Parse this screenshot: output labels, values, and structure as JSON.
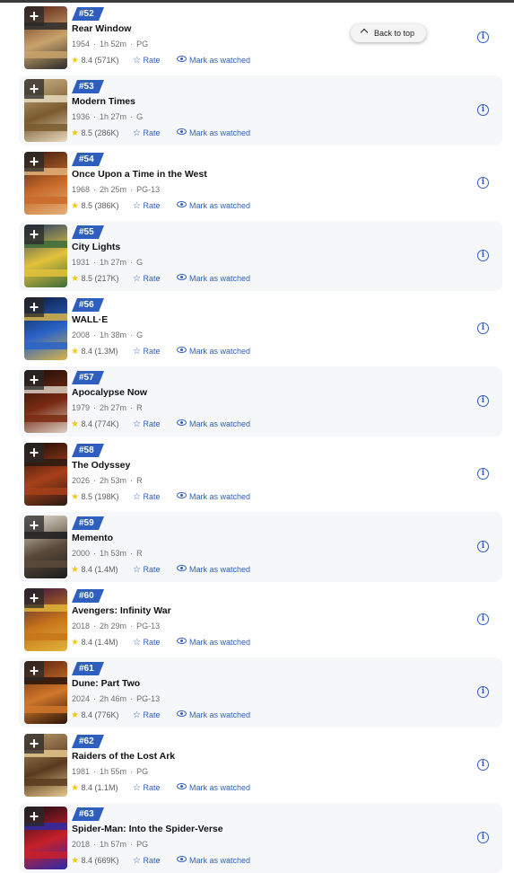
{
  "back_to_top": "Back to top",
  "labels": {
    "rate": "Rate",
    "mark_watched": "Mark as watched",
    "plus": "+",
    "info": "i",
    "star": "★"
  },
  "colors": {
    "accent": "#2f5fbe",
    "star": "#f5c518"
  },
  "movies": [
    {
      "rank": "#52",
      "title": "Rear Window",
      "year": "1954",
      "runtime": "1h 52m",
      "cert": "PG",
      "rating": "8.4 (571K)",
      "poster": [
        "#5a1e12",
        "#c9a36b",
        "#2b2b2b"
      ]
    },
    {
      "rank": "#53",
      "title": "Modern Times",
      "year": "1936",
      "runtime": "1h 27m",
      "cert": "G",
      "rating": "8.5 (286K)",
      "poster": [
        "#cbb58a",
        "#7a5a2e",
        "#e8dcc0"
      ]
    },
    {
      "rank": "#54",
      "title": "Once Upon a Time in the West",
      "year": "1968",
      "runtime": "2h 25m",
      "cert": "PG-13",
      "rating": "8.5 (386K)",
      "poster": [
        "#3a1a10",
        "#c96a2a",
        "#e2b27a"
      ]
    },
    {
      "rank": "#55",
      "title": "City Lights",
      "year": "1931",
      "runtime": "1h 27m",
      "cert": "G",
      "rating": "8.5 (217K)",
      "poster": [
        "#1f3b6b",
        "#e3c23a",
        "#3c6b3a"
      ]
    },
    {
      "rank": "#56",
      "title": "WALL·E",
      "year": "2008",
      "runtime": "1h 38m",
      "cert": "G",
      "rating": "8.4 (1.3M)",
      "poster": [
        "#0b1a3a",
        "#2a63c8",
        "#d9b347"
      ]
    },
    {
      "rank": "#57",
      "title": "Apocalypse Now",
      "year": "1979",
      "runtime": "2h 27m",
      "cert": "R",
      "rating": "8.4 (774K)",
      "poster": [
        "#1a0d08",
        "#7a2a12",
        "#d9cfc4"
      ]
    },
    {
      "rank": "#58",
      "title": "The Odyssey",
      "year": "2026",
      "runtime": "2h 53m",
      "cert": "R",
      "rating": "8.5 (198K)",
      "poster": [
        "#140806",
        "#a8401a",
        "#2a1a14"
      ]
    },
    {
      "rank": "#59",
      "title": "Memento",
      "year": "2000",
      "runtime": "1h 53m",
      "cert": "R",
      "rating": "8.4 (1.4M)",
      "poster": [
        "#e9e4da",
        "#5a4a3a",
        "#1c1c1c"
      ]
    },
    {
      "rank": "#60",
      "title": "Avengers: Infinity War",
      "year": "2018",
      "runtime": "2h 29m",
      "cert": "PG-13",
      "rating": "8.4 (1.4M)",
      "poster": [
        "#3a1240",
        "#c8741a",
        "#e0b43a"
      ]
    },
    {
      "rank": "#61",
      "title": "Dune: Part Two",
      "year": "2024",
      "runtime": "2h 46m",
      "cert": "PG-13",
      "rating": "8.4 (776K)",
      "poster": [
        "#5a1e0c",
        "#d0782a",
        "#2a140a"
      ]
    },
    {
      "rank": "#62",
      "title": "Raiders of the Lost Ark",
      "year": "1981",
      "runtime": "1h 55m",
      "cert": "PG",
      "rating": "8.4 (1.1M)",
      "poster": [
        "#b89a6a",
        "#5a3a1e",
        "#e4c88e"
      ]
    },
    {
      "rank": "#63",
      "title": "Spider-Man: Into the Spider-Verse",
      "year": "2018",
      "runtime": "1h 57m",
      "cert": "PG",
      "rating": "8.4 (669K)",
      "poster": [
        "#1a0a14",
        "#c8202a",
        "#2a2aa8"
      ]
    }
  ]
}
